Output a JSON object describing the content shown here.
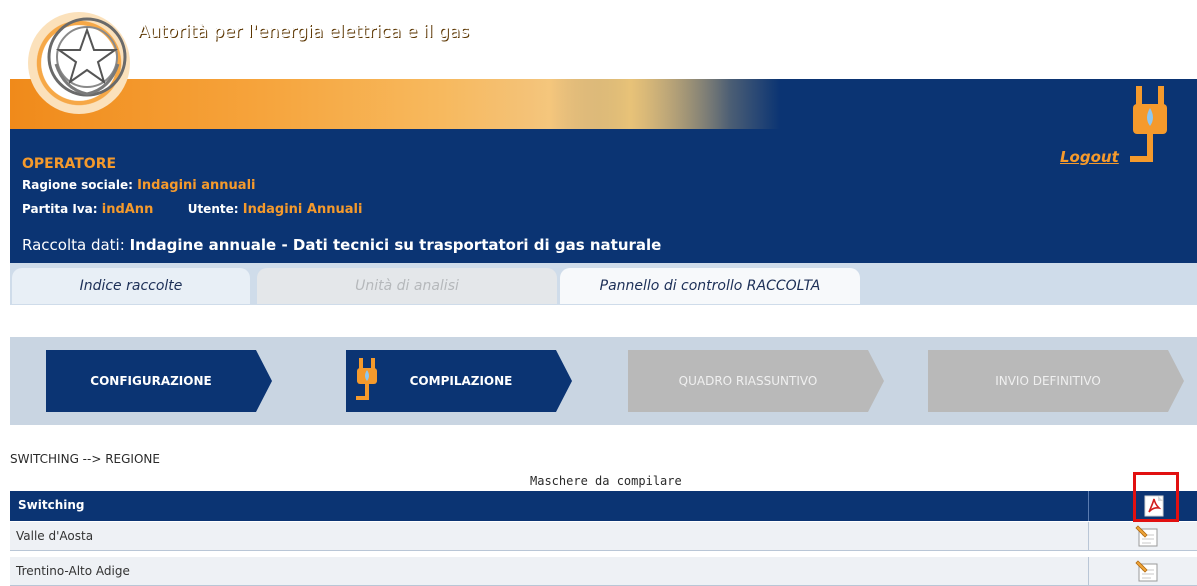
{
  "header": {
    "title": "Autorità per l'energia elettrica e il gas",
    "logout_label": "Logout"
  },
  "operator": {
    "heading": "OPERATORE",
    "ragione_label": "Ragione sociale:",
    "ragione_value": "Indagini annuali",
    "partita_label": "Partita Iva:",
    "partita_value": "indAnn",
    "utente_label": "Utente:",
    "utente_value": "Indagini Annuali",
    "raccolta_label": "Raccolta dati:",
    "raccolta_value": "Indagine annuale - Dati tecnici su trasportatori di gas naturale"
  },
  "tabs": [
    {
      "label": "Indice raccolte",
      "state": "normal"
    },
    {
      "label": "Unità di analisi",
      "state": "disabled"
    },
    {
      "label": "Pannello di controllo RACCOLTA",
      "state": "active"
    }
  ],
  "steps": [
    {
      "label": "CONFIGURAZIONE",
      "state": "active"
    },
    {
      "label": "COMPILAZIONE",
      "state": "active"
    },
    {
      "label": "QUADRO RIASSUNTIVO",
      "state": "disabled"
    },
    {
      "label": "INVIO DEFINITIVO",
      "state": "disabled"
    }
  ],
  "breadcrumb": "SWITCHING --> REGIONE",
  "table": {
    "caption": "Maschere da compilare",
    "header_label": "Switching",
    "rows": [
      {
        "label": "Valle d'Aosta"
      },
      {
        "label": "Trentino-Alto Adige"
      }
    ]
  },
  "colors": {
    "navy": "#0b3473",
    "orange": "#f59a2c",
    "highlight": "#e11010"
  },
  "icons": [
    "emblem-icon",
    "plug-icon",
    "pdf-icon",
    "edit-icon"
  ]
}
